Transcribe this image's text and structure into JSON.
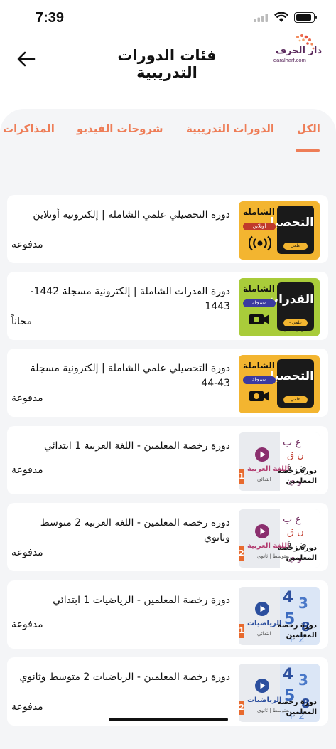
{
  "status_bar": {
    "time": "7:39"
  },
  "header": {
    "title": "فئات الدورات التدريبية",
    "logo_ar": "دار الحرف",
    "logo_en": "daralharf.com"
  },
  "tabs": [
    {
      "label": "الكل",
      "active": true
    },
    {
      "label": "الدورات التدريبية",
      "active": false
    },
    {
      "label": "شروحات الفيديو",
      "active": false
    },
    {
      "label": "المذاكرات",
      "active": false
    }
  ],
  "accent_color": "#ee7d57",
  "courses": [
    {
      "title": "دورة التحصيلي علمي الشاملة | إلكترونية أونلاين",
      "price": "مدفوعة",
      "thumb": {
        "style": "yellow",
        "big": "التحصيلي",
        "chip": "علمي",
        "badge": "الشاملة",
        "pill": "أونلاين",
        "pill_color": "#c0392b",
        "icon": "broadcast-icon"
      }
    },
    {
      "title": "دورة القدرات الشاملة | إلكترونية مسجلة 1442-1443",
      "price": "مجاناً",
      "thumb": {
        "style": "green",
        "big": "القدرات",
        "chip": "علمي - شرعي - أدبي",
        "badge": "الشاملة",
        "pill": "مسجلة",
        "pill_color": "#3b3aa0",
        "icon": "video-icon"
      }
    },
    {
      "title": "دورة التحصيلي علمي الشاملة | إلكترونية مسجلة 43-44",
      "price": "مدفوعة",
      "thumb": {
        "style": "yellow",
        "big": "التحصيلي",
        "chip": "علمي",
        "badge": "الشاملة",
        "pill": "مسجلة",
        "pill_color": "#3b3aa0",
        "icon": "video-icon"
      }
    },
    {
      "title": "دورة رخصة المعلمين - اللغة العربية 1 ابتدائي",
      "price": "مدفوعة",
      "thumb": {
        "style": "grey",
        "subject": "اللغة العربية",
        "level": "ابتدائي",
        "label1": "دورة رخصة",
        "label2": "المعلمين",
        "num": "1",
        "subject_color": "#b23a6e",
        "play_color": "#8b2f6e",
        "pattern": "letters"
      }
    },
    {
      "title": "دورة رخصة المعلمين - اللغة العربية 2 متوسط وثانوي",
      "price": "مدفوعة",
      "thumb": {
        "style": "grey",
        "subject": "اللغة العربية",
        "level": "متوسط | ثانوي",
        "label1": "دورة رخصة",
        "label2": "المعلمين",
        "num": "2",
        "subject_color": "#b23a6e",
        "play_color": "#8b2f6e",
        "pattern": "letters"
      }
    },
    {
      "title": "دورة رخصة المعلمين - الرياضيات 1 ابتدائي",
      "price": "مدفوعة",
      "thumb": {
        "style": "grey",
        "subject": "الرياضيات",
        "level": "ابتدائي",
        "label1": "دورة رخصة",
        "label2": "المعلمين",
        "num": "1",
        "subject_color": "#2c4f9e",
        "play_color": "#2c4f9e",
        "pattern": "numbers"
      }
    },
    {
      "title": "دورة رخصة المعلمين - الرياضيات 2 متوسط وثانوي",
      "price": "مدفوعة",
      "thumb": {
        "style": "grey",
        "subject": "الرياضيات",
        "level": "متوسط | ثانوي",
        "label1": "دورة رخصة",
        "label2": "المعلمين",
        "num": "2",
        "subject_color": "#2c4f9e",
        "play_color": "#2c4f9e",
        "pattern": "numbers"
      }
    }
  ]
}
